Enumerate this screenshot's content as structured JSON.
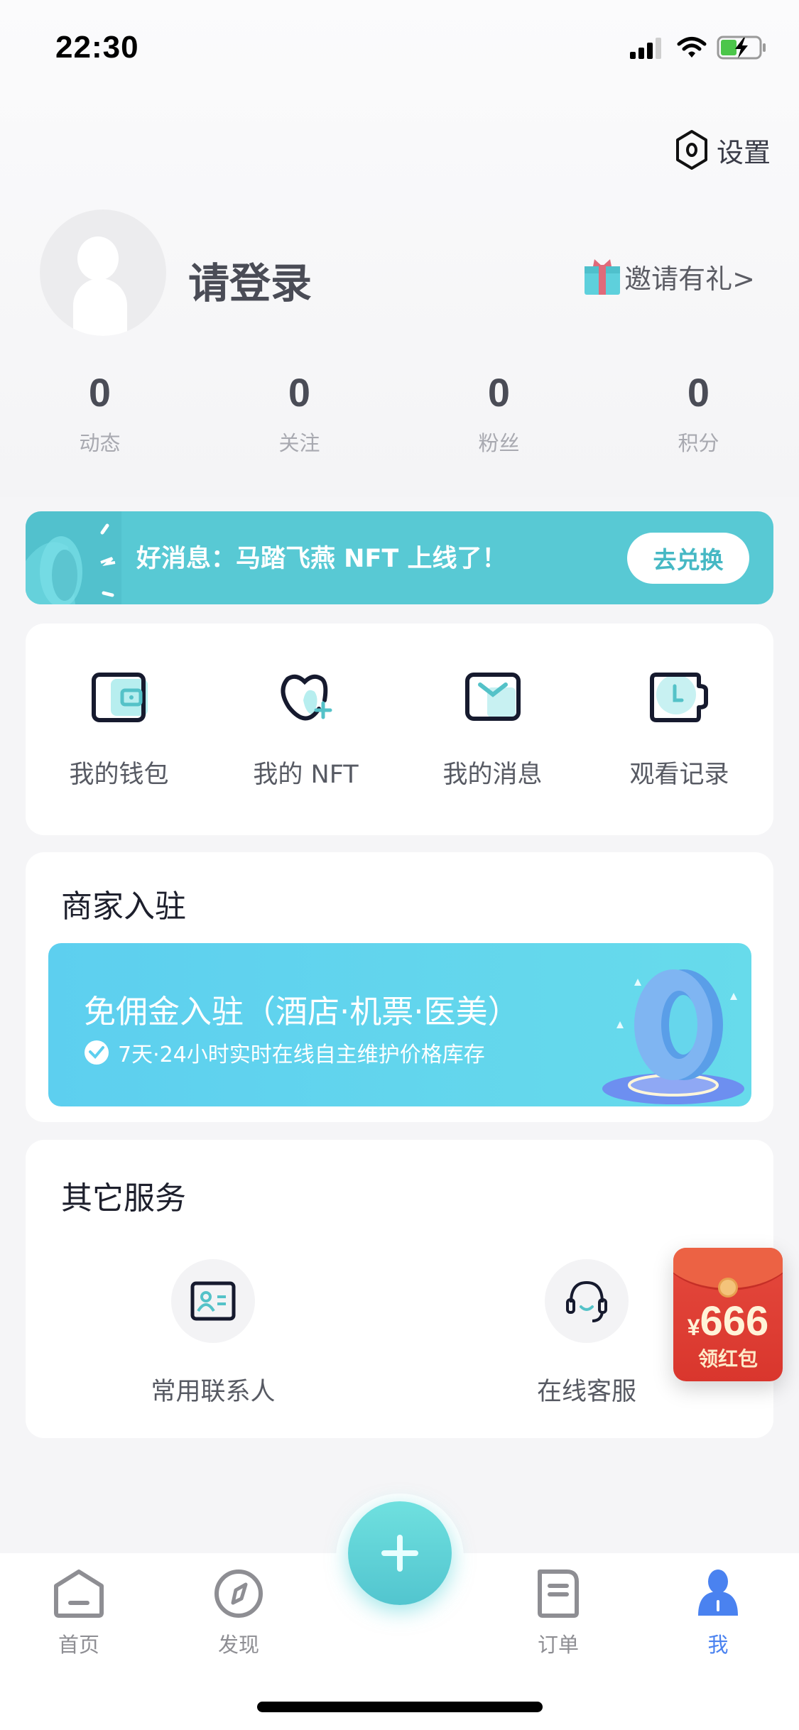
{
  "status_bar": {
    "time": "22:30",
    "battery": "charging"
  },
  "header": {
    "settings_label": "设置",
    "login_label": "请登录",
    "invite_label": "邀请有礼>"
  },
  "stats": [
    {
      "value": "0",
      "label": "动态"
    },
    {
      "value": "0",
      "label": "关注"
    },
    {
      "value": "0",
      "label": "粉丝"
    },
    {
      "value": "0",
      "label": "积分"
    }
  ],
  "news_banner": {
    "text": "好消息：马踏飞燕 NFT 上线了！",
    "button": "去兑换",
    "color": "#58c9d4"
  },
  "quick_actions": [
    {
      "label": "我的钱包",
      "icon": "wallet-icon"
    },
    {
      "label": "我的 NFT",
      "icon": "heart-plus-icon"
    },
    {
      "label": "我的消息",
      "icon": "message-icon"
    },
    {
      "label": "观看记录",
      "icon": "history-icon"
    }
  ],
  "merchant": {
    "title": "商家入驻",
    "banner_heading": "免佣金入驻（酒店·机票·医美）",
    "banner_sub": "7天·24小时实时在线自主维护价格库存"
  },
  "other_services": {
    "title": "其它服务",
    "items": [
      {
        "label": "常用联系人",
        "icon": "contact-card-icon"
      },
      {
        "label": "在线客服",
        "icon": "headset-icon"
      }
    ]
  },
  "red_packet": {
    "currency": "¥",
    "amount": "666",
    "label": "领红包"
  },
  "tabbar": {
    "items": [
      {
        "label": "首页",
        "icon": "home-icon",
        "active": false
      },
      {
        "label": "发现",
        "icon": "compass-icon",
        "active": false
      },
      {
        "label": "订单",
        "icon": "order-icon",
        "active": false
      },
      {
        "label": "我",
        "icon": "profile-icon",
        "active": true
      }
    ],
    "active_color": "#4a82f0",
    "fab_color": "#5ccfd6"
  }
}
